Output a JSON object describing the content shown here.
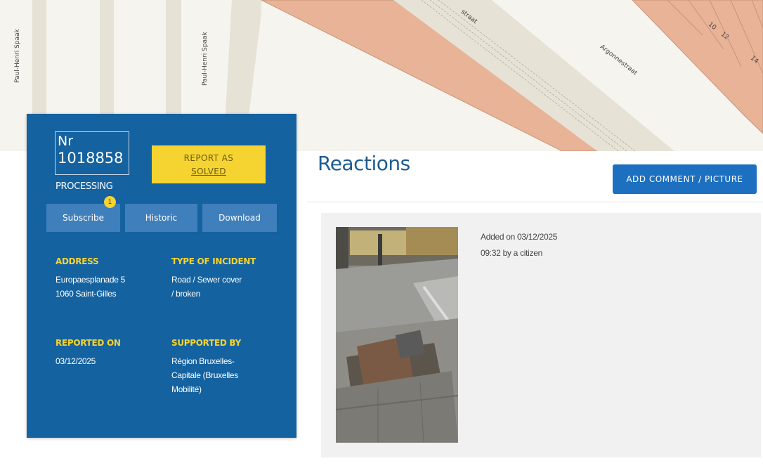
{
  "map": {
    "streets": [
      "Paul-Henri Spaak",
      "Paul-Henri Spaak",
      "Argonnestraat",
      "straat"
    ],
    "house_numbers": [
      "10",
      "12",
      "14"
    ]
  },
  "incident": {
    "nr_label": "Nr",
    "nr_value": "1018858",
    "status": "PROCESSING",
    "report_solved_line1": "REPORT AS",
    "report_solved_line2": "SOLVED",
    "tabs": {
      "subscribe": "Subscribe",
      "subscribe_badge": "1",
      "historic": "Historic",
      "download": "Download"
    },
    "address_label": "ADDRESS",
    "address_line1": "Europaesplanade 5",
    "address_line2": "1060 Saint-Gilles",
    "type_label": "TYPE OF INCIDENT",
    "type_line1": "Road / Sewer cover",
    "type_line2": "/ broken",
    "reported_label": "REPORTED ON",
    "reported_value": "03/12/2025",
    "supported_label": "SUPPORTED BY",
    "supported_line1": "Région Bruxelles-",
    "supported_line2": "Capitale (Bruxelles",
    "supported_line3": "Mobilité)"
  },
  "reactions": {
    "title": "Reactions",
    "add_button": "ADD COMMENT / PICTURE",
    "comment": {
      "line1": "Added on 03/12/2025",
      "line2": "09:32 by a citizen"
    }
  },
  "colors": {
    "card_blue": "#1462a0",
    "accent_yellow": "#f5d431",
    "button_blue": "#1d6fc0",
    "building_salmon": "#e8b397",
    "road_beige": "#e6e2d6"
  }
}
